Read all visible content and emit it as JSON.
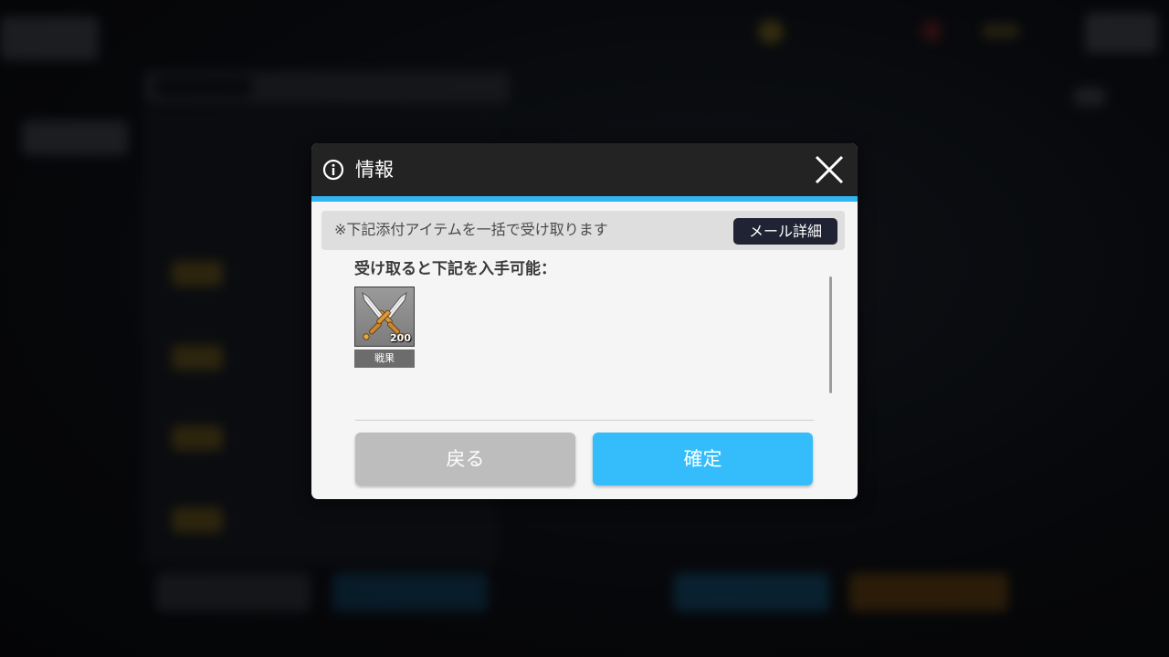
{
  "dialog": {
    "title": "情報",
    "title_icon": "info-icon",
    "close_icon": "close-icon",
    "notice": "※下記添付アイテムを一括で受け取ります",
    "mail_detail_label": "メール詳細",
    "obtain_label": "受け取ると下記を入手可能：",
    "rewards": [
      {
        "icon": "crossed-swords-icon",
        "count": "200",
        "name": "戦果"
      }
    ],
    "back_label": "戻る",
    "confirm_label": "確定"
  },
  "colors": {
    "header_bg": "#232323",
    "accent": "#2fb5f2",
    "confirm_button": "#35bdfb",
    "back_button": "#bdbdbd",
    "mail_detail_button": "#1f2333"
  }
}
